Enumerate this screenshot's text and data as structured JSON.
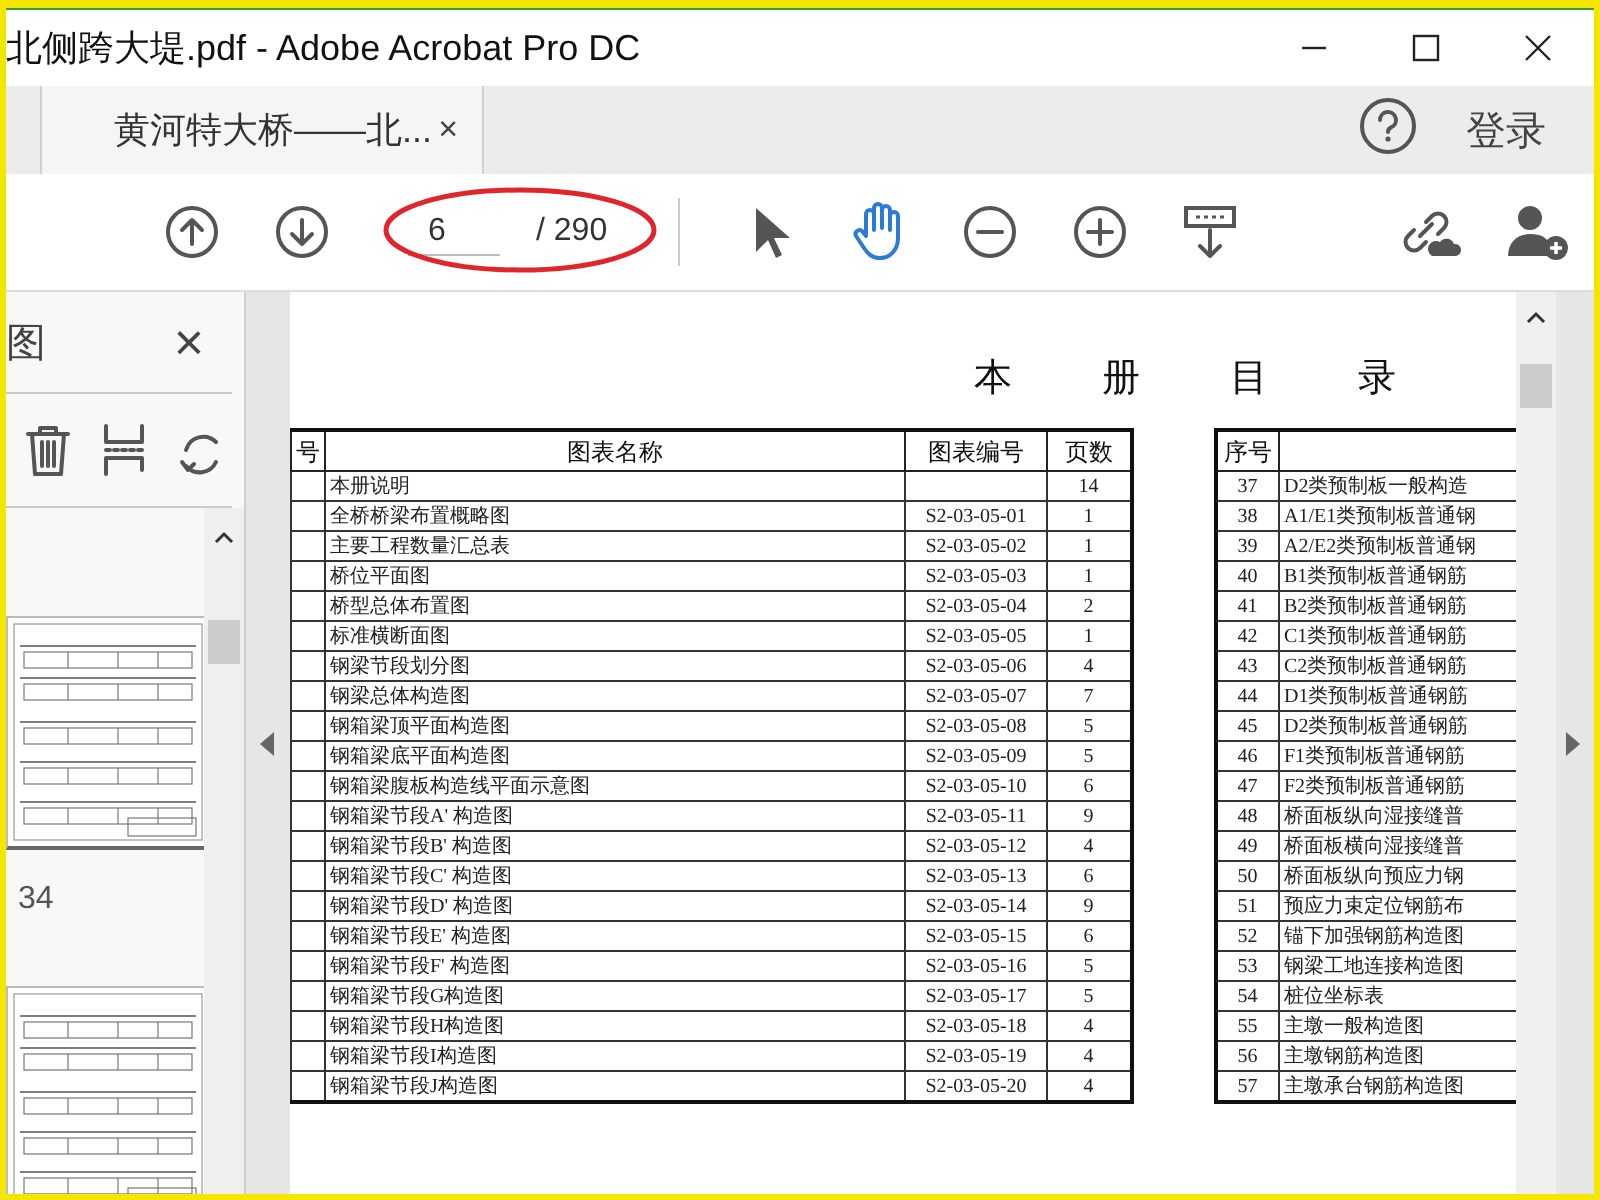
{
  "window": {
    "title": "北侧跨大堤.pdf - Adobe Acrobat Pro DC"
  },
  "tabs": [
    {
      "label": "黄河特大桥——北...",
      "selected": true,
      "close": "×"
    }
  ],
  "account": {
    "sign_in": "登录"
  },
  "toolbar": {
    "page_number": "6",
    "page_total": "/ 290",
    "tools": [
      {
        "kind": "select",
        "selected": false
      },
      {
        "kind": "hand",
        "selected": true
      }
    ]
  },
  "sidebar": {
    "title": "图",
    "close": "×",
    "thumbnail_label": "34"
  },
  "document": {
    "heading": [
      "本",
      "册",
      "目",
      "录"
    ],
    "left_table": {
      "columns": [
        "号",
        "图表名称",
        "图表编号",
        "页数"
      ],
      "rows": [
        {
          "name": "本册说明",
          "pages": "14"
        },
        {
          "name": "全桥桥梁布置概略图",
          "code": "S2-03-05-01",
          "pages": "1"
        },
        {
          "name": "主要工程数量汇总表",
          "code": "S2-03-05-02",
          "pages": "1"
        },
        {
          "name": "桥位平面图",
          "code": "S2-03-05-03",
          "pages": "1"
        },
        {
          "name": "桥型总体布置图",
          "code": "S2-03-05-04",
          "pages": "2"
        },
        {
          "name": "标准横断面图",
          "code": "S2-03-05-05",
          "pages": "1"
        },
        {
          "name": "钢梁节段划分图",
          "code": "S2-03-05-06",
          "pages": "4"
        },
        {
          "name": "钢梁总体构造图",
          "code": "S2-03-05-07",
          "pages": "7"
        },
        {
          "name": "钢箱梁顶平面构造图",
          "code": "S2-03-05-08",
          "pages": "5"
        },
        {
          "name": "钢箱梁底平面构造图",
          "code": "S2-03-05-09",
          "pages": "5"
        },
        {
          "name": "钢箱梁腹板构造线平面示意图",
          "code": "S2-03-05-10",
          "pages": "6"
        },
        {
          "name": "钢箱梁节段A' 构造图",
          "code": "S2-03-05-11",
          "pages": "9"
        },
        {
          "name": "钢箱梁节段B' 构造图",
          "code": "S2-03-05-12",
          "pages": "4"
        },
        {
          "name": "钢箱梁节段C' 构造图",
          "code": "S2-03-05-13",
          "pages": "6"
        },
        {
          "name": "钢箱梁节段D' 构造图",
          "code": "S2-03-05-14",
          "pages": "9"
        },
        {
          "name": "钢箱梁节段E' 构造图",
          "code": "S2-03-05-15",
          "pages": "6"
        },
        {
          "name": "钢箱梁节段F' 构造图",
          "code": "S2-03-05-16",
          "pages": "5"
        },
        {
          "name": "钢箱梁节段G构造图",
          "code": "S2-03-05-17",
          "pages": "5"
        },
        {
          "name": "钢箱梁节段H构造图",
          "code": "S2-03-05-18",
          "pages": "4"
        },
        {
          "name": "钢箱梁节段I构造图",
          "code": "S2-03-05-19",
          "pages": "4"
        },
        {
          "name": "钢箱梁节段J构造图",
          "code": "S2-03-05-20",
          "pages": "4"
        }
      ]
    },
    "right_table": {
      "columns": [
        "序号"
      ],
      "rows": [
        {
          "no": "37",
          "name": "D2类预制板一般构造"
        },
        {
          "no": "38",
          "name": "A1/E1类预制板普通钢"
        },
        {
          "no": "39",
          "name": "A2/E2类预制板普通钢"
        },
        {
          "no": "40",
          "name": "B1类预制板普通钢筋"
        },
        {
          "no": "41",
          "name": "B2类预制板普通钢筋"
        },
        {
          "no": "42",
          "name": "C1类预制板普通钢筋"
        },
        {
          "no": "43",
          "name": "C2类预制板普通钢筋"
        },
        {
          "no": "44",
          "name": "D1类预制板普通钢筋"
        },
        {
          "no": "45",
          "name": "D2类预制板普通钢筋"
        },
        {
          "no": "46",
          "name": "F1类预制板普通钢筋"
        },
        {
          "no": "47",
          "name": "F2类预制板普通钢筋"
        },
        {
          "no": "48",
          "name": "桥面板纵向湿接缝普"
        },
        {
          "no": "49",
          "name": "桥面板横向湿接缝普"
        },
        {
          "no": "50",
          "name": "桥面板纵向预应力钢"
        },
        {
          "no": "51",
          "name": "预应力束定位钢筋布"
        },
        {
          "no": "52",
          "name": "锚下加强钢筋构造图"
        },
        {
          "no": "53",
          "name": "钢梁工地连接构造图"
        },
        {
          "no": "54",
          "name": "桩位坐标表"
        },
        {
          "no": "55",
          "name": "主墩一般构造图"
        },
        {
          "no": "56",
          "name": "主墩钢筋构造图"
        },
        {
          "no": "57",
          "name": "主墩承台钢筋构造图"
        }
      ]
    }
  }
}
